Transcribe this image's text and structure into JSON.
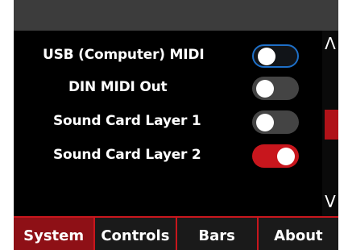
{
  "settings": [
    {
      "label": "USB (Computer) MIDI",
      "state": "off",
      "focused": true
    },
    {
      "label": "DIN MIDI Out",
      "state": "off",
      "focused": false
    },
    {
      "label": "Sound Card Layer 1",
      "state": "off",
      "focused": false
    },
    {
      "label": "Sound Card Layer 2",
      "state": "on",
      "focused": false
    }
  ],
  "scroll": {
    "up_glyph": "Λ",
    "down_glyph": "V"
  },
  "tabs": [
    {
      "label": "System",
      "active": true
    },
    {
      "label": "Controls",
      "active": false
    },
    {
      "label": "Bars",
      "active": false
    },
    {
      "label": "About",
      "active": false
    }
  ],
  "colors": {
    "accent": "#c8161d",
    "active_tab": "#8e1016",
    "focus_ring": "#1e6fc7",
    "toggle_off": "#444444",
    "background": "#000000"
  }
}
